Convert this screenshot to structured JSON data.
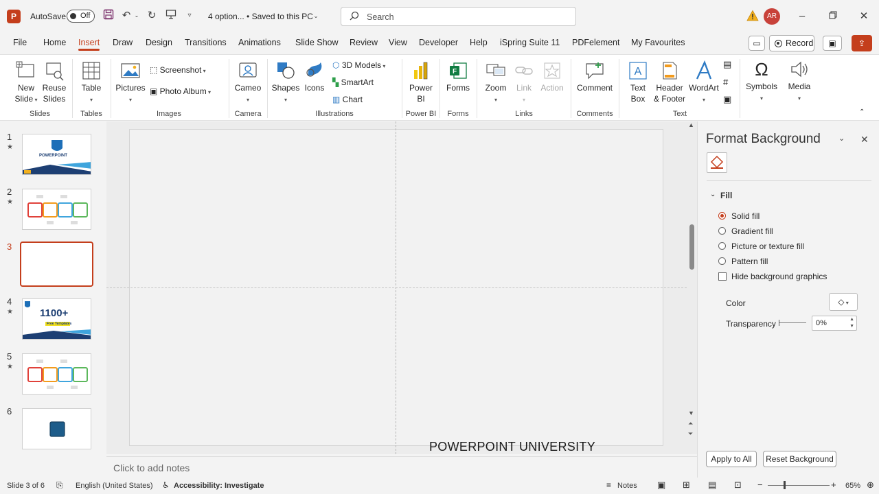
{
  "titlebar": {
    "app_logo": "P",
    "autosave_label": "AutoSave",
    "autosave_state": "Off",
    "doc_name": "4 option... • Saved to this PC",
    "search_placeholder": "Search",
    "avatar_initials": "AR",
    "icons": [
      "save-icon",
      "undo-icon",
      "redo-icon",
      "present-from-beginning-icon",
      "customize-qat-icon",
      "warning-icon",
      "minimize-icon",
      "restore-icon",
      "close-icon"
    ]
  },
  "menu": {
    "tabs": [
      "File",
      "Home",
      "Insert",
      "Draw",
      "Design",
      "Transitions",
      "Animations",
      "Slide Show",
      "Review",
      "View",
      "Developer",
      "Help",
      "iSpring Suite 11",
      "PDFelement",
      "My Favourites"
    ],
    "active_tab": "Insert",
    "record_label": "Record"
  },
  "ribbon": {
    "new_slide": "New Slide",
    "new_slide_l1": "New",
    "new_slide_l2": "Slide",
    "reuse_l1": "Reuse",
    "reuse_l2": "Slides",
    "table": "Table",
    "pictures": "Pictures",
    "screenshot": "Screenshot",
    "photo_album": "Photo Album",
    "cameo": "Cameo",
    "shapes": "Shapes",
    "icons": "Icons",
    "models_3d": "3D Models",
    "smartart": "SmartArt",
    "chart": "Chart",
    "powerbi_l1": "Power",
    "powerbi_l2": "BI",
    "forms": "Forms",
    "zoom": "Zoom",
    "link": "Link",
    "action": "Action",
    "comment": "Comment",
    "textbox_l1": "Text",
    "textbox_l2": "Box",
    "header_l1": "Header",
    "header_l2": "& Footer",
    "wordart": "WordArt",
    "symbols": "Symbols",
    "media": "Media",
    "groups": {
      "slides": "Slides",
      "tables": "Tables",
      "images": "Images",
      "camera": "Camera",
      "illustrations": "Illustrations",
      "powerbi": "Power BI",
      "forms": "Forms",
      "links": "Links",
      "comments": "Comments",
      "text": "Text"
    }
  },
  "slides": [
    {
      "num": "1",
      "star": "★",
      "thumb_text": "POWERPOINT"
    },
    {
      "num": "2",
      "star": "★"
    },
    {
      "num": "3",
      "star": ""
    },
    {
      "num": "4",
      "star": "★",
      "thumb_text": "1100+",
      "thumb_sub": "Free Templates"
    },
    {
      "num": "5",
      "star": "★"
    },
    {
      "num": "6",
      "star": ""
    }
  ],
  "stage": {
    "watermark": "POWERPOINT UNIVERSITY",
    "notes_placeholder": "Click to add notes"
  },
  "pane": {
    "title": "Format Background",
    "fill_heading": "Fill",
    "options": [
      "Solid fill",
      "Gradient fill",
      "Picture or texture fill",
      "Pattern fill"
    ],
    "selected_option": "Solid fill",
    "hide_bg": "Hide background graphics",
    "color_label": "Color",
    "transparency_label": "Transparency",
    "transparency_value": "0%",
    "apply_all": "Apply to All",
    "reset_bg": "Reset Background"
  },
  "status": {
    "slide_info": "Slide 3 of 6",
    "language": "English (United States)",
    "accessibility": "Accessibility: Investigate",
    "notes": "Notes",
    "zoom": "65%"
  },
  "colors": {
    "accent": "#c43e1c",
    "panel_bg": "#f3f3f3",
    "ribbon_bg": "#ffffff"
  }
}
